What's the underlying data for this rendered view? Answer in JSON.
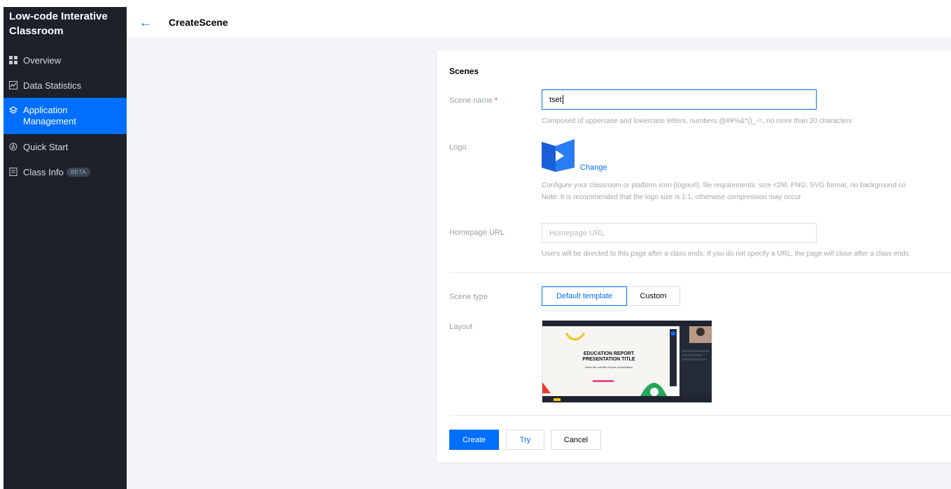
{
  "sidebar": {
    "brand": "Low-code Interative Classroom",
    "items": [
      {
        "label": "Overview",
        "icon": "grid-icon"
      },
      {
        "label": "Data Statistics",
        "icon": "chart-icon"
      },
      {
        "label": "Application Management",
        "icon": "layers-icon",
        "active": true
      },
      {
        "label": "Quick Start",
        "icon": "rocket-icon"
      },
      {
        "label": "Class Info",
        "icon": "document-icon",
        "badge": "BETA"
      }
    ]
  },
  "header": {
    "back_icon": "arrow-left-icon",
    "title": "CreateScene"
  },
  "form": {
    "section_title": "Scenes",
    "scene_name": {
      "label": "Scene name",
      "required_mark": "*",
      "value": "tset",
      "hint": "Composed of uppercase and lowercase letters, numbers @#¥%&*()_-=, no more than 20 characters"
    },
    "logo": {
      "label": "Logo",
      "change_label": "Change",
      "hint_line1": "Configure your classroom or platform icon (logourl), file requirements: size <2M, PNG, SVG format, no background co",
      "hint_line2": "Note: It is recommended that the logo size is 1:1, otherwise compression may occur"
    },
    "homepage": {
      "label": "Homepage URL",
      "placeholder": "Homepage URL",
      "value": "",
      "hint": "Users will be directed to this page after a class ends. If you do not specify a URL, the page will close after a class ends."
    },
    "scene_type": {
      "label": "Scene type",
      "options": [
        "Default template",
        "Custom"
      ],
      "selected": "Default template"
    },
    "layout": {
      "label": "Layout",
      "preview_title_line1": "EDUCATION REPORT",
      "preview_title_line2": "PRESENTATION TITLE",
      "preview_subtitle": "Insert the sub title of your presentation"
    },
    "buttons": {
      "create": "Create",
      "try": "Try",
      "cancel": "Cancel"
    }
  },
  "colors": {
    "primary": "#006eff",
    "sidebar_bg": "#1d2129",
    "required": "#e54545"
  }
}
